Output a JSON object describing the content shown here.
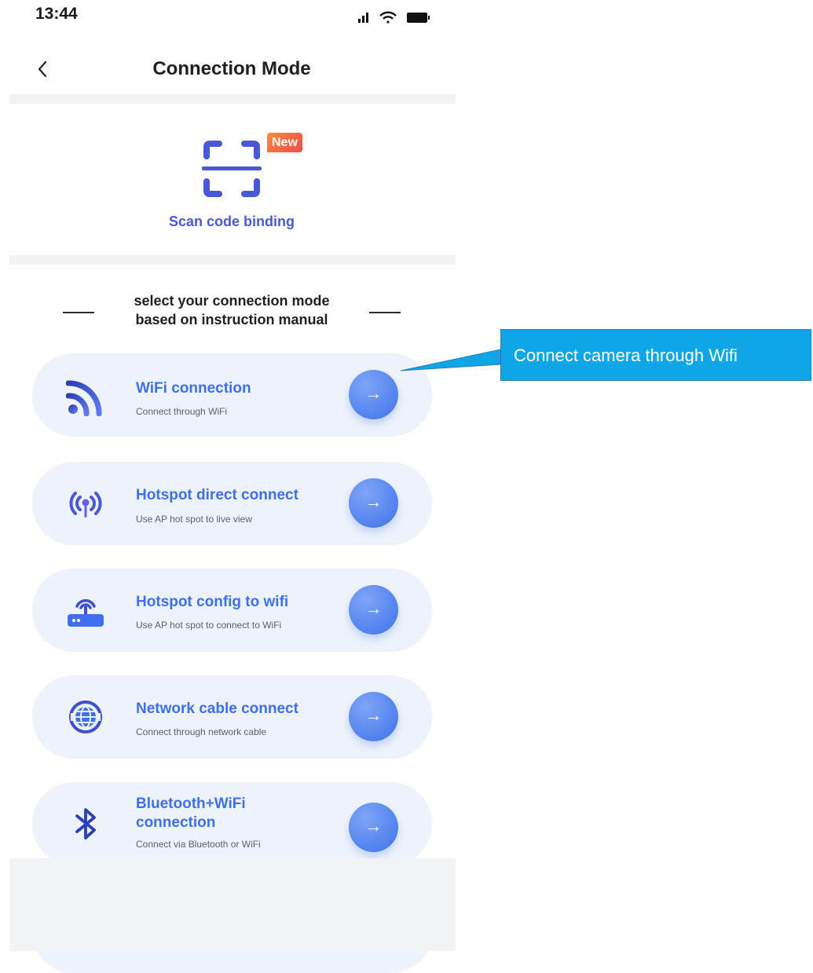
{
  "status_bar": {
    "time": "13:44"
  },
  "nav": {
    "title": "Connection Mode"
  },
  "scan": {
    "label": "Scan code binding",
    "badge": "New"
  },
  "section": {
    "heading_line1": "select your connection mode",
    "heading_line2": "based on instruction manual"
  },
  "options": [
    {
      "title": "WiFi connection",
      "subtitle": "Connect through WiFi",
      "icon": "wifi-icon"
    },
    {
      "title": "Hotspot direct connect",
      "subtitle": "Use AP hot spot to live view",
      "icon": "hotspot-icon"
    },
    {
      "title": "Hotspot config to wifi",
      "subtitle": "Use AP hot spot to connect to WiFi",
      "icon": "router-icon"
    },
    {
      "title": "Network cable connect",
      "subtitle": "Connect through network cable",
      "icon": "globe-icon"
    },
    {
      "title_line1": "Bluetooth+WiFi",
      "title_line2": "connection",
      "subtitle": "Connect via Bluetooth or WiFi",
      "icon": "bluetooth-icon"
    }
  ],
  "callout": {
    "text": "Connect camera through Wifi"
  },
  "colors": {
    "accent": "#3e6ff0",
    "card_bg": "#eef3fb",
    "scan_label": "#4a58d8",
    "callout_bg": "#0fa6e8"
  }
}
